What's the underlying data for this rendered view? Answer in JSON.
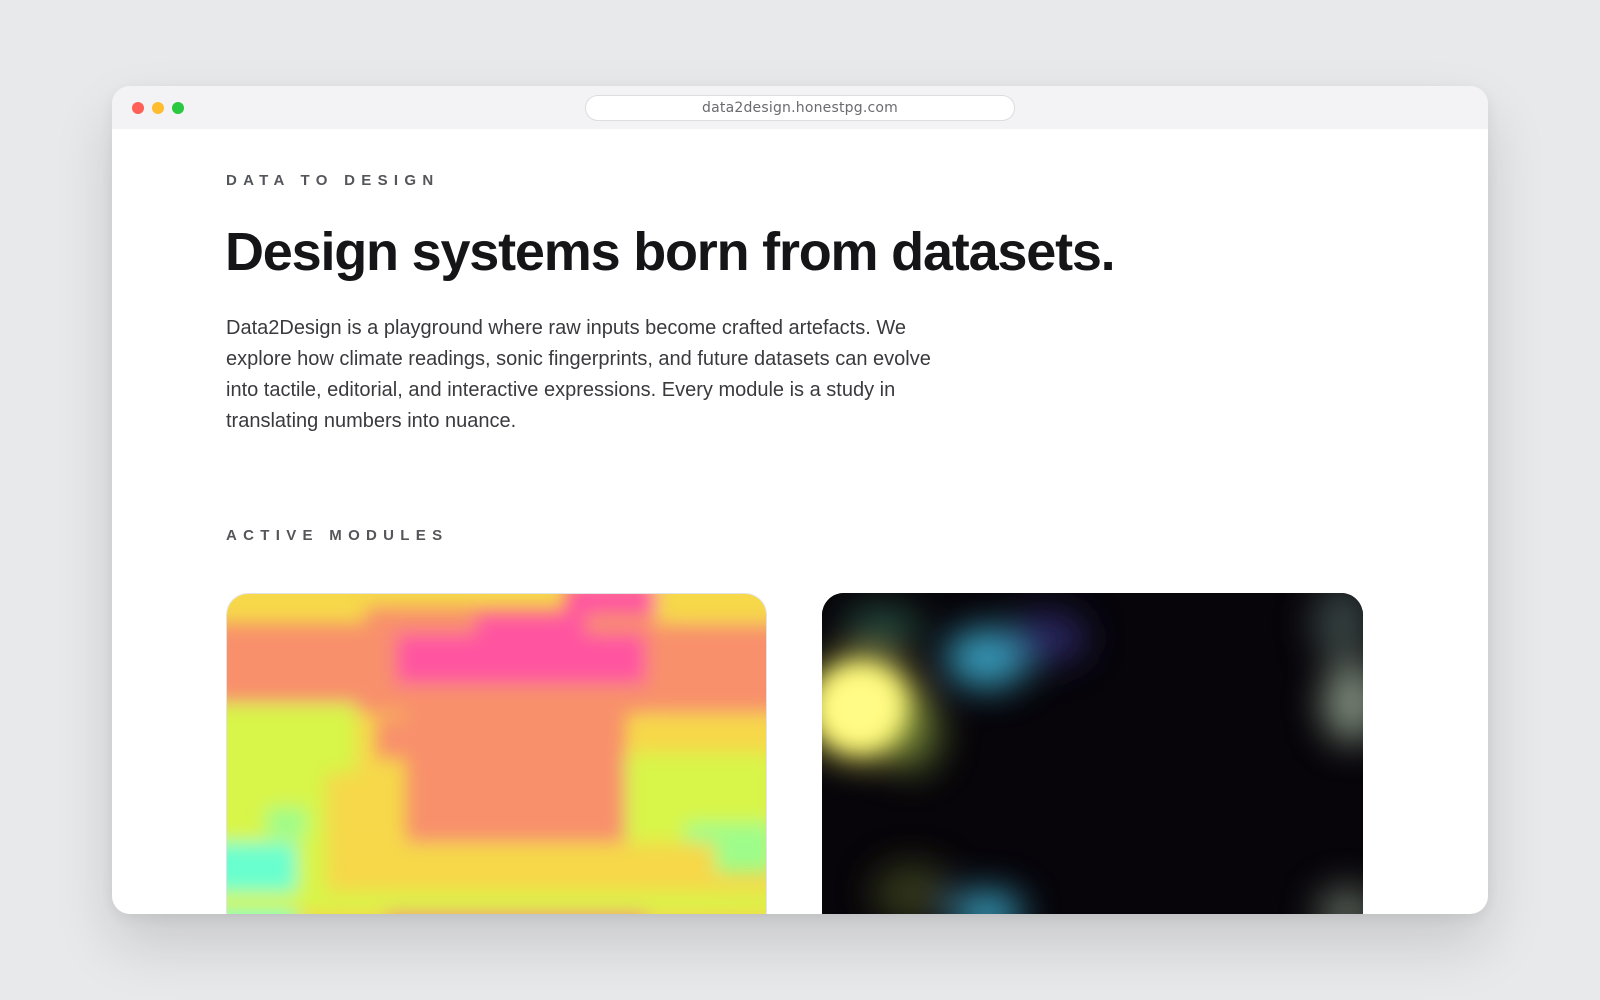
{
  "browser": {
    "url": "data2design.honestpg.com"
  },
  "hero": {
    "eyebrow": "DATA TO DESIGN",
    "title": "Design systems born from datasets.",
    "intro": "Data2Design is a playground where raw inputs become crafted artefacts. We explore how climate readings, sonic fingerprints, and future datasets can evolve into tactile, editorial, and interactive expressions. Every module is a study in translating numbers into nuance."
  },
  "modules": {
    "heading": "ACTIVE MODULES",
    "cards": [
      {
        "icon": "climate-heatmap-artwork"
      },
      {
        "icon": "sonic-glow-artwork"
      }
    ]
  },
  "colors": {
    "background": "#e8e9eb",
    "heat_yellow": "#f6d84a",
    "heat_salmon": "#f8906c",
    "heat_pink": "#ff55a0",
    "heat_lime": "#d8f549",
    "heat_mint": "#69ffcf",
    "night_bg": "#07050a",
    "glow_yellow": "#fff86a",
    "glow_cyan": "#3fb5d8"
  }
}
